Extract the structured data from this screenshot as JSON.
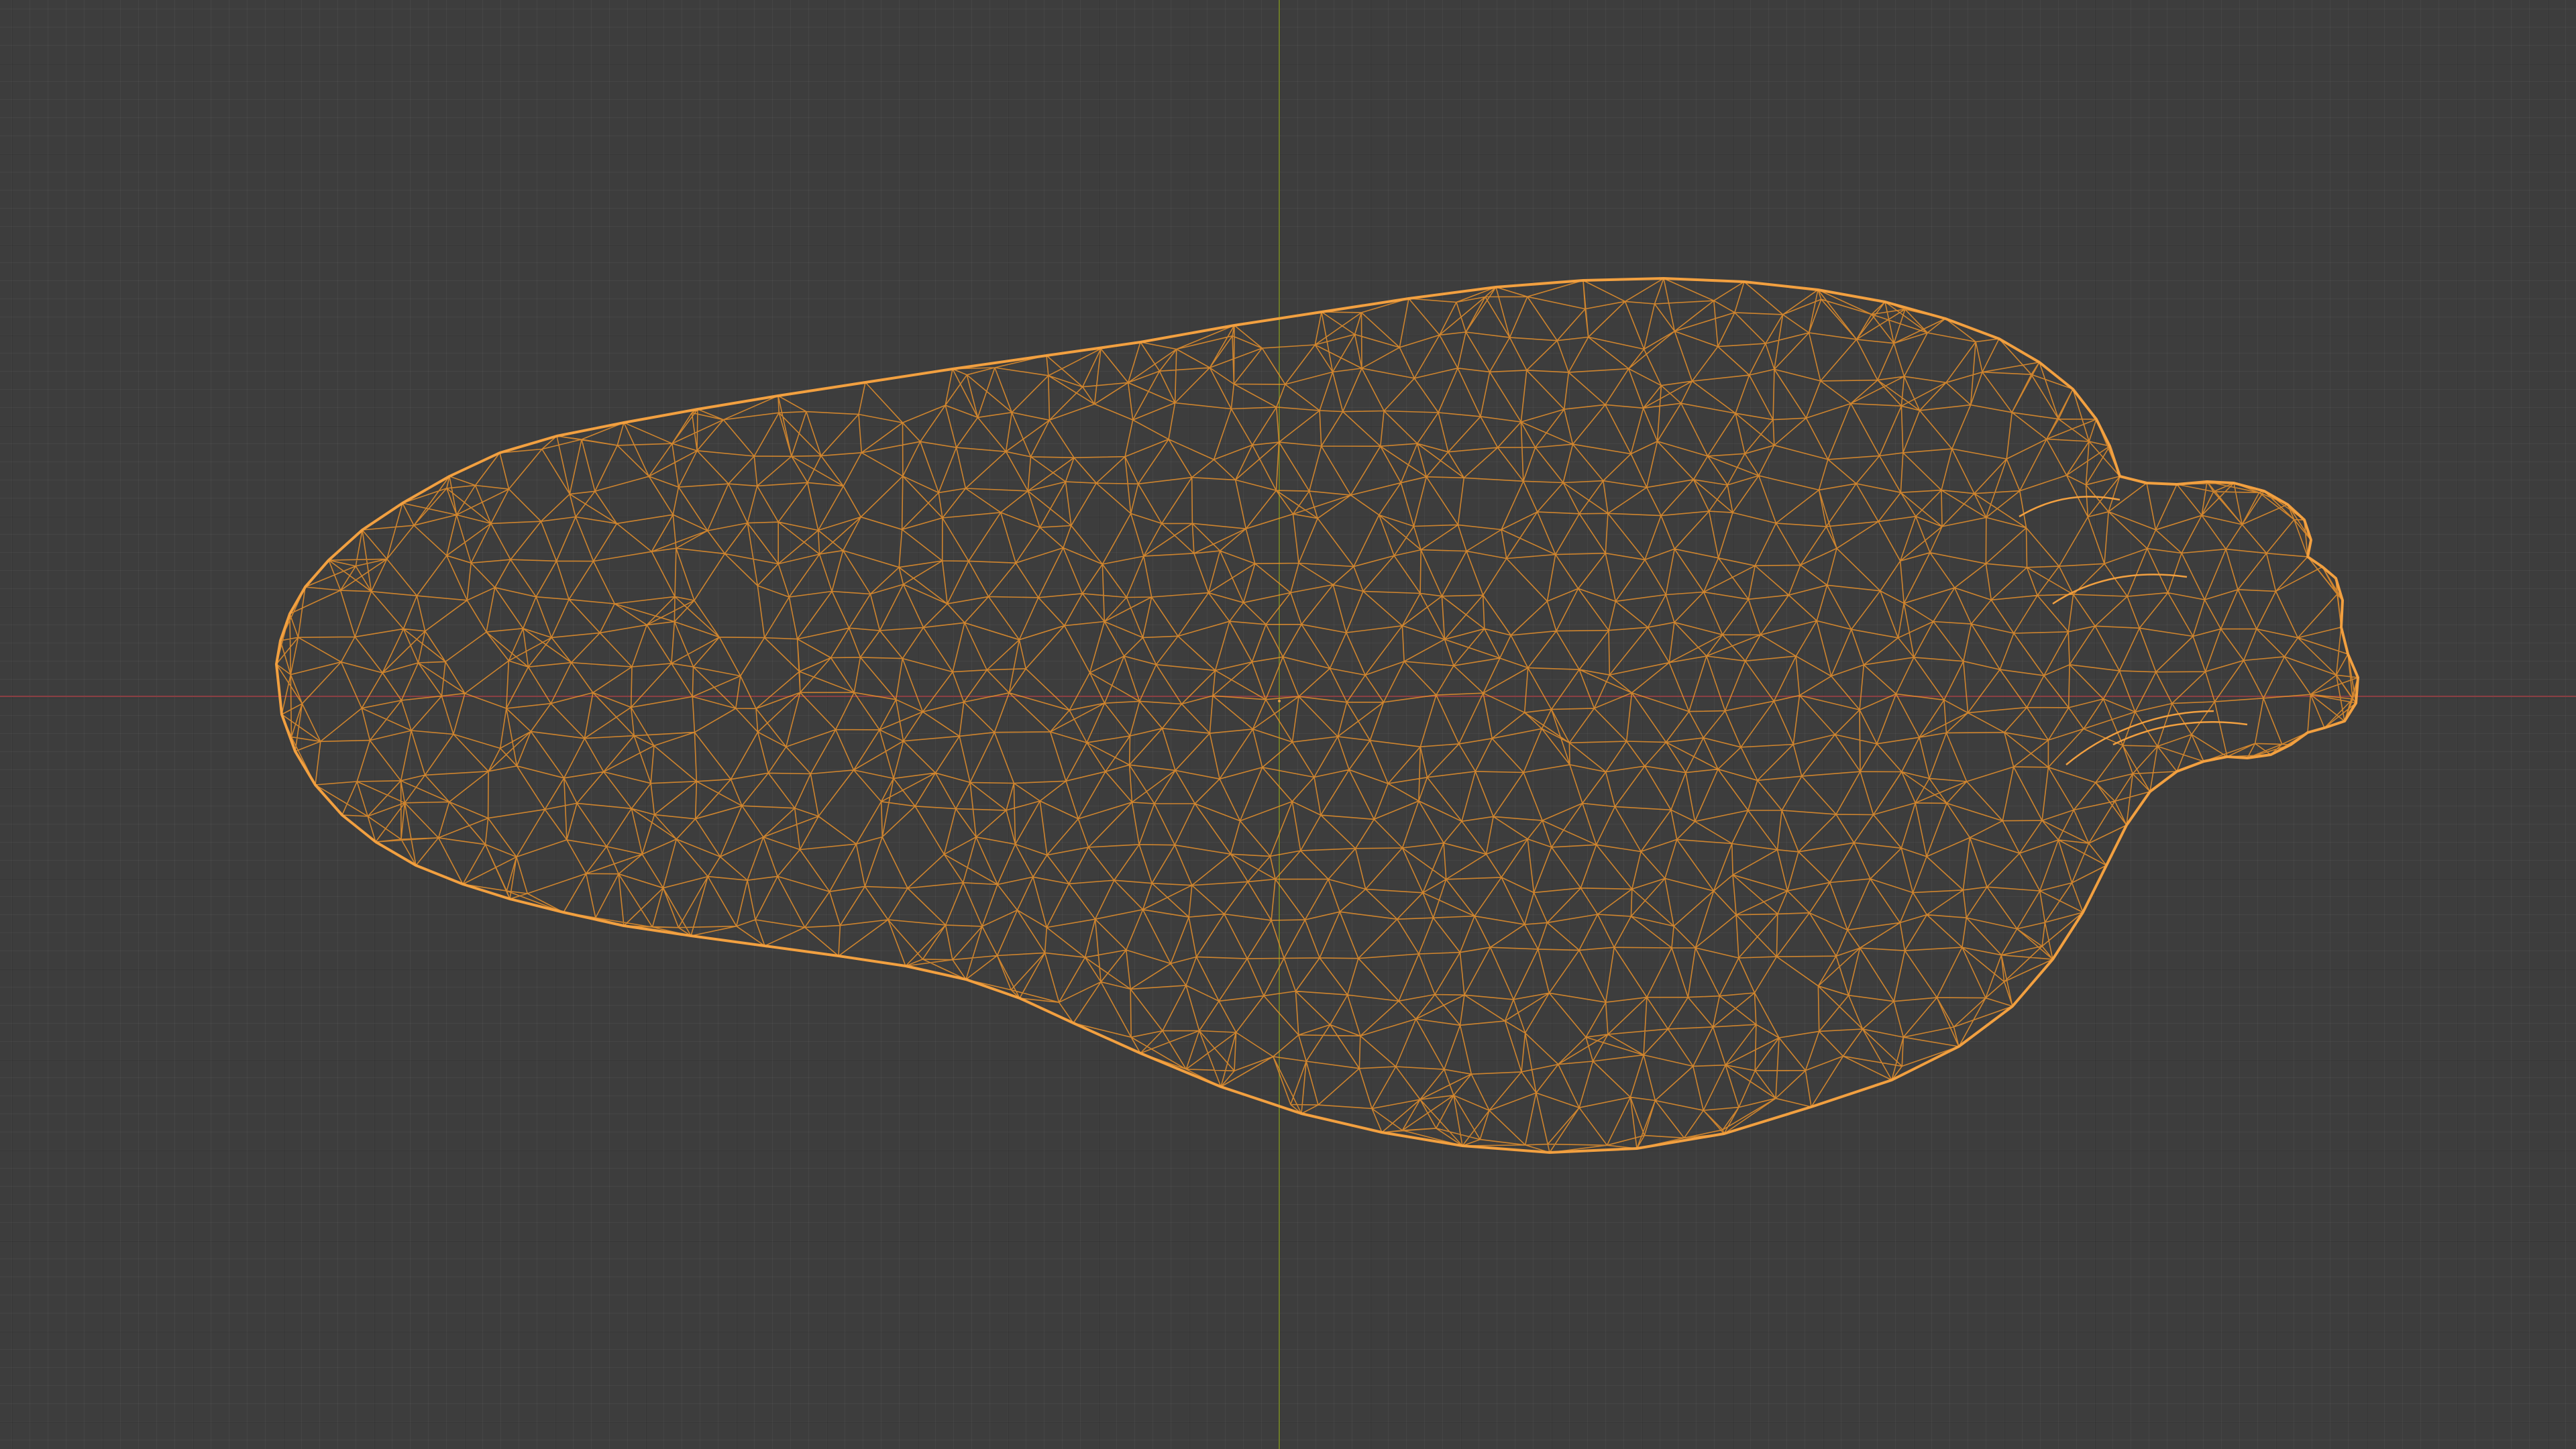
{
  "viewport": {
    "background_color": "#3d3d3d",
    "grid": true,
    "x_axis_color": "#8a3e42",
    "y_axis_color": "#6b7a2a"
  },
  "object": {
    "shape": "gourd",
    "display": "wireframe",
    "selected": true,
    "wire_color": "#e8902c",
    "outline_color": "#f2a040"
  },
  "origin": {
    "color": "#e8a040"
  }
}
